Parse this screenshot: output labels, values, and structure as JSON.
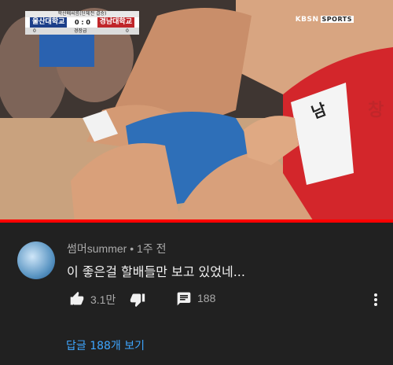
{
  "video": {
    "scoreboard": {
      "top_label": "학산배씨름(단체전 결승)",
      "team_left": "울산대학교",
      "team_right": "경남대학교",
      "score_left": "0",
      "score_right": "0",
      "score_sep": ":",
      "sub_left": "0",
      "sub_center": "경장급",
      "sub_right": "0",
      "team_left_color": "#1d3f8a",
      "team_right_color": "#c0262a"
    },
    "broadcaster": {
      "main": "KBSN",
      "sub": "SPORTS"
    },
    "shorts_text_1": "창",
    "shorts_text_2": "남",
    "progress_fraction": 1.0
  },
  "comment": {
    "author": "썸머summer",
    "separator": "•",
    "time": "1주 전",
    "text": "이 좋은걸 할배들만 보고 있었네...",
    "like_count": "3.1만",
    "reply_count": "188",
    "view_replies": "답글 188개 보기",
    "link_color": "#3ea6ff"
  }
}
